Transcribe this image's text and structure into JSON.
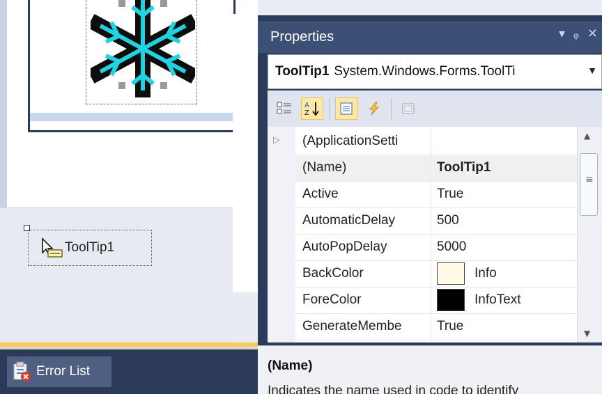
{
  "properties_window": {
    "title": "Properties",
    "title_buttons": {
      "dropdown": "▾",
      "pin": "ᵩ",
      "close": "✕"
    },
    "object_selector": {
      "name": "ToolTip1",
      "type": "System.Windows.Forms.ToolTi"
    },
    "toolbar": {
      "categorized_icon": "categorized-icon",
      "alphabetical_icon": "alphabetical-icon",
      "properties_icon": "properties-icon",
      "events_icon": "events-icon",
      "property_pages_icon": "property-pages-icon"
    },
    "grid_rows": [
      {
        "name": "(ApplicationSetti",
        "value": "",
        "expandable": true
      },
      {
        "name": "(Name)",
        "value": "ToolTip1",
        "bold": true
      },
      {
        "name": "Active",
        "value": "True"
      },
      {
        "name": "AutomaticDelay",
        "value": "500"
      },
      {
        "name": "AutoPopDelay",
        "value": "5000"
      },
      {
        "name": "BackColor",
        "value": "Info",
        "swatch": "#fffbe6"
      },
      {
        "name": "ForeColor",
        "value": "InfoText",
        "swatch": "#000000"
      },
      {
        "name": "GenerateMembe",
        "value": "True"
      }
    ],
    "description": {
      "title": "(Name)",
      "text": "Indicates the name used in code to identify"
    }
  },
  "designer": {
    "component_tray": {
      "label": "ToolTip1",
      "icon": "tooltip-component-icon"
    }
  },
  "bottom_panel": {
    "error_list_label": "Error List",
    "icon": "error-list-icon"
  },
  "colors": {
    "window_chrome": "#2b3b59",
    "title_bar": "#3c4f75",
    "active_toolbar": "#ffe8a6",
    "snowflake": "#1fd3e0"
  }
}
